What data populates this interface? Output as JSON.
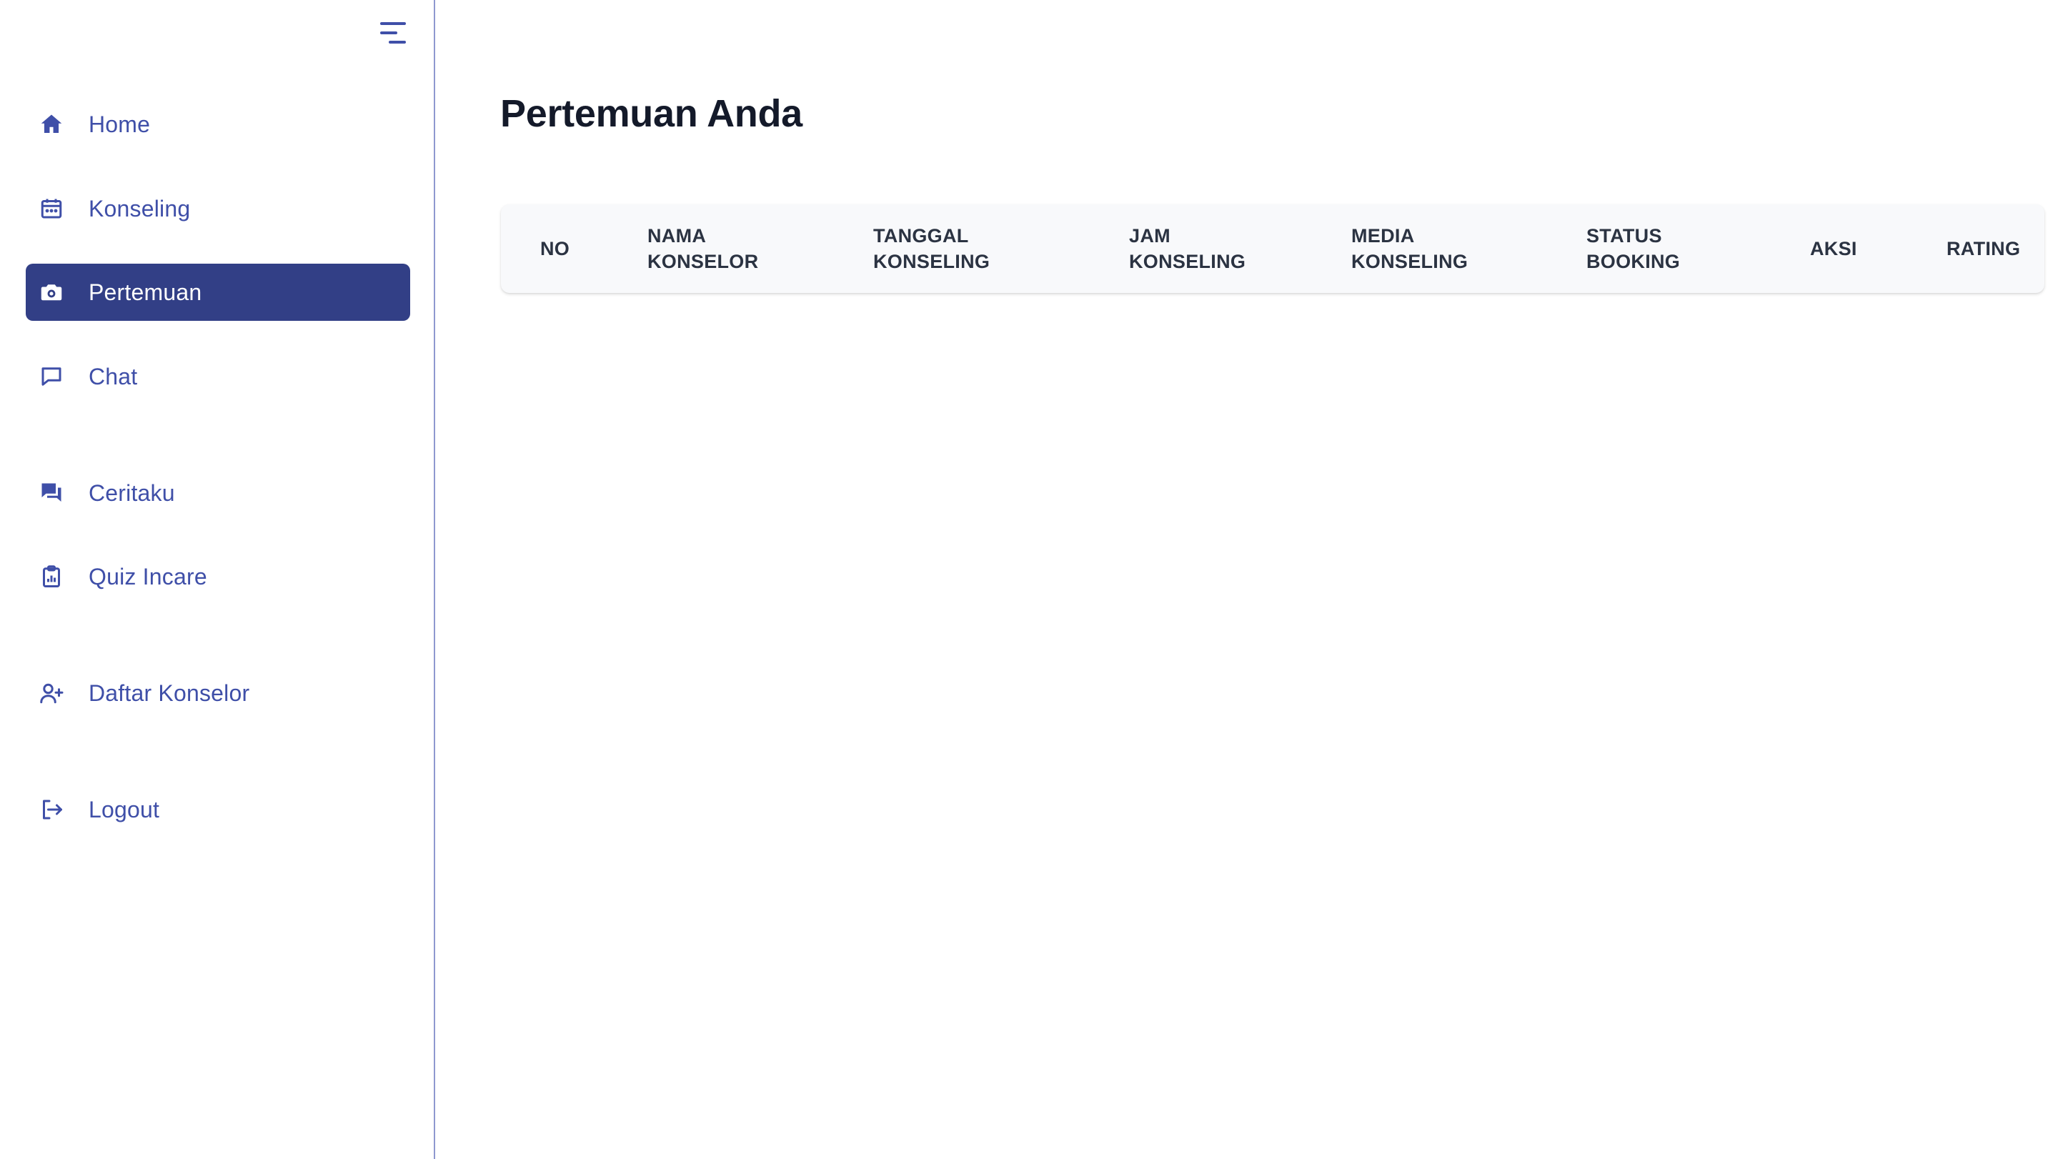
{
  "sidebar": {
    "items": [
      {
        "label": "Home",
        "icon": "home-icon"
      },
      {
        "label": "Konseling",
        "icon": "calendar-icon"
      },
      {
        "label": "Pertemuan",
        "icon": "camera-icon",
        "active": true
      },
      {
        "label": "Chat",
        "icon": "chat-bubble-icon"
      },
      {
        "label": "Ceritaku",
        "icon": "chat-alt-icon"
      },
      {
        "label": "Quiz Incare",
        "icon": "clipboard-chart-icon"
      },
      {
        "label": "Daftar Konselor",
        "icon": "user-add-icon"
      },
      {
        "label": "Logout",
        "icon": "logout-icon"
      }
    ]
  },
  "main": {
    "title": "Pertemuan Anda",
    "table": {
      "headers": [
        {
          "line1": "NO",
          "line2": ""
        },
        {
          "line1": "NAMA",
          "line2": "KONSELOR"
        },
        {
          "line1": "TANGGAL",
          "line2": "KONSELING"
        },
        {
          "line1": "JAM",
          "line2": "KONSELING"
        },
        {
          "line1": "MEDIA",
          "line2": "KONSELING"
        },
        {
          "line1": "STATUS",
          "line2": "BOOKING"
        },
        {
          "line1": "AKSI",
          "line2": ""
        },
        {
          "line1": "RATING",
          "line2": ""
        }
      ],
      "rows": []
    }
  },
  "colors": {
    "accent": "#3f4fa8",
    "active_bg": "#323f86",
    "sidebar_border": "#8f98cf",
    "title": "#141a2a",
    "table_header_bg": "#f8f9fb"
  }
}
